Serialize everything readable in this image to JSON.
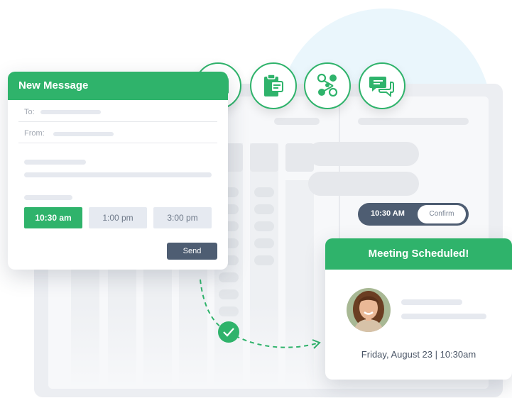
{
  "message_card": {
    "title": "New Message",
    "to_label": "To:",
    "from_label": "From:",
    "time_slots": [
      {
        "label": "10:30 am",
        "selected": true
      },
      {
        "label": "1:00 pm",
        "selected": false
      },
      {
        "label": "3:00 pm",
        "selected": false
      }
    ],
    "send_label": "Send"
  },
  "icons": [
    "mail-icon",
    "clipboard-icon",
    "people-network-icon",
    "chat-bubbles-icon"
  ],
  "calendar": {
    "selected_time": "10:30 AM",
    "confirm_label": "Confirm"
  },
  "meeting_card": {
    "title": "Meeting Scheduled!",
    "date": "Friday, August 23 | 10:30am"
  },
  "colors": {
    "accent": "#2fb36b",
    "dark": "#4e5d72",
    "background_blob": "#eaf6fc"
  }
}
